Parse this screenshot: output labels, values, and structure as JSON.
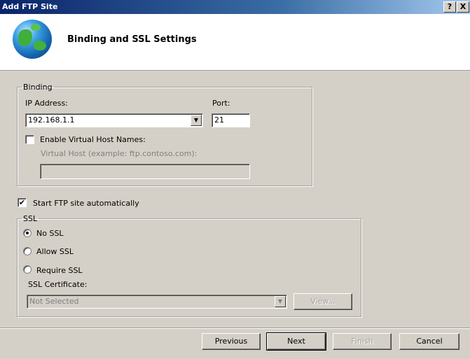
{
  "window": {
    "title": "Add FTP Site",
    "help_label": "?",
    "close_label": "X"
  },
  "header": {
    "title": "Binding and SSL Settings",
    "icon": "globe-icon"
  },
  "binding": {
    "legend": "Binding",
    "ip_label": "IP Address:",
    "ip_value": "192.168.1.1",
    "port_label": "Port:",
    "port_value": "21",
    "virtual_host_check_label": "Enable Virtual Host Names:",
    "virtual_host_checked": false,
    "virtual_host_label": "Virtual Host (example: ftp.contoso.com):",
    "virtual_host_value": ""
  },
  "start_auto": {
    "label": "Start FTP site automatically",
    "checked": true
  },
  "ssl": {
    "legend": "SSL",
    "options": [
      {
        "label": "No SSL",
        "selected": true
      },
      {
        "label": "Allow SSL",
        "selected": false
      },
      {
        "label": "Require SSL",
        "selected": false
      }
    ],
    "cert_label": "SSL Certificate:",
    "cert_value": "Not Selected",
    "view_label": "View..."
  },
  "footer": {
    "previous": "Previous",
    "next": "Next",
    "finish": "Finish",
    "cancel": "Cancel"
  }
}
